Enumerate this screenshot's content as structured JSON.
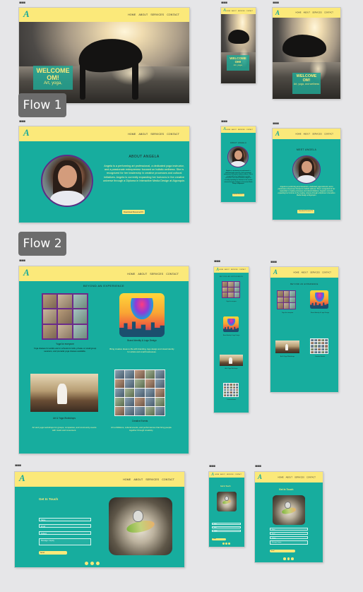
{
  "frame_label": "▪▪▪",
  "brand": {
    "logo": "A"
  },
  "nav": [
    "HOME",
    "ABOUT",
    "SERVICES",
    "CONTACT"
  ],
  "flows": {
    "flow1": "Flow 1",
    "flow2": "Flow 2"
  },
  "hero": {
    "title": "WELCOME OM!",
    "subtitle": "Art, yoga, and wellness",
    "subtitle_short": "Art, yoga,"
  },
  "about": {
    "heading": "ABOUT ANGELA",
    "heading_alt": "MEET ANGELA",
    "text": "Angela is a performing art professional, a dedicated yoga instructor, and a passionate entrepreneur focused on holistic wellness. She is recognized for her leadership in creative processes and cultural initiatives. Angela is currently expanding her horizons in the creative universe through a Diploma in Interactive Media Design at Algonquin.",
    "button": "Download Resume/CV"
  },
  "services": {
    "heading": "BEYOND AN EXPERIENCE",
    "items": [
      {
        "title": "Yoga for everyone",
        "text": "Yoga classes for adults and in schools for kids, private or small group sessions, and prenatal yoga classes available."
      },
      {
        "title": "Brand Identity & Logo Design",
        "text": "Bring creative ideas to life with branding, logo design and visual identity for artists and small businesses."
      },
      {
        "title": "Art & Yoga Workshops",
        "text": "Art and yoga workshops for groups, companies, and community events with music and movement."
      },
      {
        "title": "Creative Events",
        "text": "Art exhibitions, cultural events, and performances that bring people together through creativity."
      }
    ]
  },
  "contact": {
    "heading": "Get In Touch",
    "heading_mobile": "Get In Touch",
    "fields": [
      "Name",
      "Email",
      "Subject",
      "Message / Inquiry"
    ],
    "send": "Send"
  },
  "colors": {
    "teal": "#17ad9e",
    "yellow": "#fbe97a",
    "purple": "#5b2c86"
  }
}
